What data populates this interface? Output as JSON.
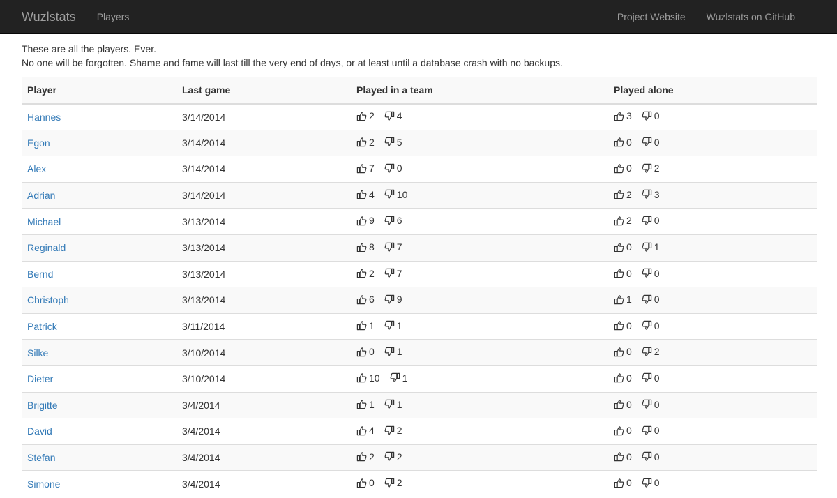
{
  "nav": {
    "brand": "Wuzlstats",
    "players": "Players",
    "project_website": "Project Website",
    "github": "Wuzlstats on GitHub"
  },
  "intro": {
    "line1": "These are all the players. Ever.",
    "line2": "No one will be forgotten. Shame and fame will last till the very end of days, or at least until a database crash with no backups."
  },
  "table": {
    "headers": [
      "Player",
      "Last game",
      "Played in a team",
      "Played alone"
    ],
    "rows": [
      {
        "name": "Hannes",
        "last_game": "3/14/2014",
        "team_up": "2",
        "team_down": "4",
        "alone_up": "3",
        "alone_down": "0"
      },
      {
        "name": "Egon",
        "last_game": "3/14/2014",
        "team_up": "2",
        "team_down": "5",
        "alone_up": "0",
        "alone_down": "0"
      },
      {
        "name": "Alex",
        "last_game": "3/14/2014",
        "team_up": "7",
        "team_down": "0",
        "alone_up": "0",
        "alone_down": "2"
      },
      {
        "name": "Adrian",
        "last_game": "3/14/2014",
        "team_up": "4",
        "team_down": "10",
        "alone_up": "2",
        "alone_down": "3"
      },
      {
        "name": "Michael",
        "last_game": "3/13/2014",
        "team_up": "9",
        "team_down": "6",
        "alone_up": "2",
        "alone_down": "0"
      },
      {
        "name": "Reginald",
        "last_game": "3/13/2014",
        "team_up": "8",
        "team_down": "7",
        "alone_up": "0",
        "alone_down": "1"
      },
      {
        "name": "Bernd",
        "last_game": "3/13/2014",
        "team_up": "2",
        "team_down": "7",
        "alone_up": "0",
        "alone_down": "0"
      },
      {
        "name": "Christoph",
        "last_game": "3/13/2014",
        "team_up": "6",
        "team_down": "9",
        "alone_up": "1",
        "alone_down": "0"
      },
      {
        "name": "Patrick",
        "last_game": "3/11/2014",
        "team_up": "1",
        "team_down": "1",
        "alone_up": "0",
        "alone_down": "0"
      },
      {
        "name": "Silke",
        "last_game": "3/10/2014",
        "team_up": "0",
        "team_down": "1",
        "alone_up": "0",
        "alone_down": "2"
      },
      {
        "name": "Dieter",
        "last_game": "3/10/2014",
        "team_up": "10",
        "team_down": "1",
        "alone_up": "0",
        "alone_down": "0"
      },
      {
        "name": "Brigitte",
        "last_game": "3/4/2014",
        "team_up": "1",
        "team_down": "1",
        "alone_up": "0",
        "alone_down": "0"
      },
      {
        "name": "David",
        "last_game": "3/4/2014",
        "team_up": "4",
        "team_down": "2",
        "alone_up": "0",
        "alone_down": "0"
      },
      {
        "name": "Stefan",
        "last_game": "3/4/2014",
        "team_up": "2",
        "team_down": "2",
        "alone_up": "0",
        "alone_down": "0"
      },
      {
        "name": "Simone",
        "last_game": "3/4/2014",
        "team_up": "0",
        "team_down": "2",
        "alone_up": "0",
        "alone_down": "0"
      }
    ]
  },
  "colors": {
    "navbar_bg": "#222222",
    "nav_text": "#9d9d9d",
    "link": "#337ab7",
    "stripe": "#f9f9f9",
    "border": "#dddddd"
  },
  "icons": {
    "up": "thumbs-up-icon",
    "down": "thumbs-down-icon"
  }
}
